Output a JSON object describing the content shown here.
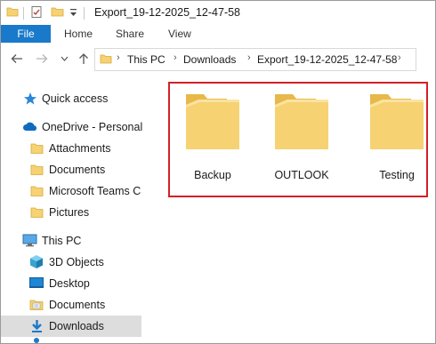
{
  "window": {
    "title": "Export_19-12-2025_12-47-58"
  },
  "ribbon": {
    "tabs": [
      "File",
      "Home",
      "Share",
      "View"
    ]
  },
  "address": {
    "crumbs": [
      "This PC",
      "Downloads",
      "Export_19-12-2025_12-47-58"
    ]
  },
  "sidebar": {
    "items": [
      {
        "label": "Quick access",
        "icon": "star-icon"
      },
      {
        "label": "OneDrive - Personal",
        "icon": "cloud-icon"
      },
      {
        "label": "Attachments",
        "icon": "folder-icon"
      },
      {
        "label": "Documents",
        "icon": "folder-icon"
      },
      {
        "label": "Microsoft Teams Ch",
        "icon": "folder-icon"
      },
      {
        "label": "Pictures",
        "icon": "folder-icon"
      },
      {
        "label": "This PC",
        "icon": "computer-icon"
      },
      {
        "label": "3D Objects",
        "icon": "cube-icon"
      },
      {
        "label": "Desktop",
        "icon": "desktop-icon"
      },
      {
        "label": "Documents",
        "icon": "documents-icon"
      },
      {
        "label": "Downloads",
        "icon": "download-icon"
      }
    ]
  },
  "folders": [
    {
      "name": "Backup"
    },
    {
      "name": "OUTLOOK"
    },
    {
      "name": "Testing"
    }
  ],
  "colors": {
    "accent": "#1979ca",
    "highlight": "#d32027",
    "folder": "#f6d273"
  }
}
